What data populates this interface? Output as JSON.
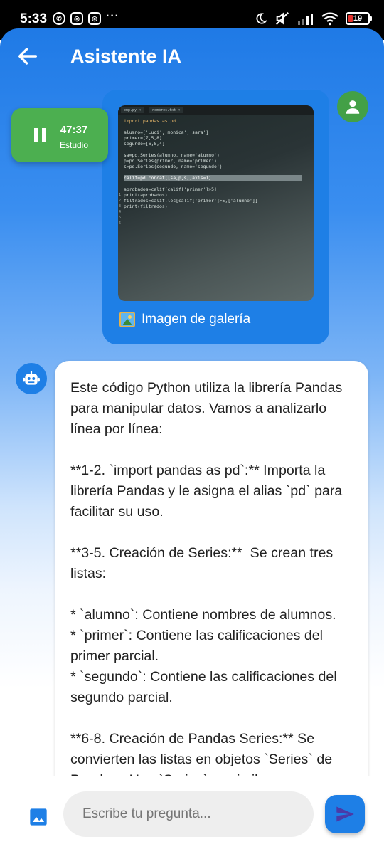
{
  "status_bar": {
    "time": "5:33",
    "app_icons": [
      "whatsapp-icon",
      "instagram-icon",
      "instagram-icon"
    ],
    "more": "···",
    "right_icons": [
      "moon-icon",
      "mute-icon",
      "signal-icon",
      "wifi-icon"
    ],
    "battery": "19",
    "battery_color": "#e5322d"
  },
  "header": {
    "title": "Asistente IA"
  },
  "timer": {
    "time": "47:37",
    "label": "Estudio",
    "color": "#4caf50"
  },
  "user_message": {
    "image_caption": "Imagen de galería",
    "photo": {
      "tabs": [
        "emp.py ×",
        "nombres.txt ×"
      ],
      "code_lines": [
        "import pandas as pd",
        "",
        "alumno=['Luci','monica','sara']",
        "primer=[7,5,8]",
        "segundo=[6,8,4]",
        "",
        "sa=pd.Series(alumno, name='alumno')",
        "p=pd.Series(primer, name='primer')",
        "s=pd.Series(segundo, name='segundo')",
        "",
        "calif=pd.concat([sa,p,s],axis=1)",
        "",
        "aprobados=calif[calif['primer']>5]",
        "print(aprobados)",
        "filtrados=calif.loc[calif['primer']>5,['alumno']]",
        "print(filtrados)"
      ],
      "line_numbers": [
        "1",
        "2",
        "3",
        "4",
        "5",
        "6"
      ]
    }
  },
  "bot_message": {
    "text": "Este código Python utiliza la librería Pandas para manipular datos. Vamos a analizarlo línea por línea:\n\n**1-2. `import pandas as pd`:** Importa la librería Pandas y le asigna el alias `pd` para facilitar su uso.\n\n**3-5. Creación de Series:**  Se crean tres listas:\n\n* `alumno`: Contiene nombres de alumnos.\n* `primer`: Contiene las calificaciones del primer parcial.\n* `segundo`: Contiene las calificaciones del segundo parcial.\n\n**6-8. Creación de Pandas Series:** Se convierten las listas en objetos `Series` de Pandas.  Una `Series` es similar a una"
  },
  "input": {
    "placeholder": "Escribe tu pregunta..."
  },
  "colors": {
    "primary": "#1e7fe6",
    "accent_green": "#43a047"
  }
}
